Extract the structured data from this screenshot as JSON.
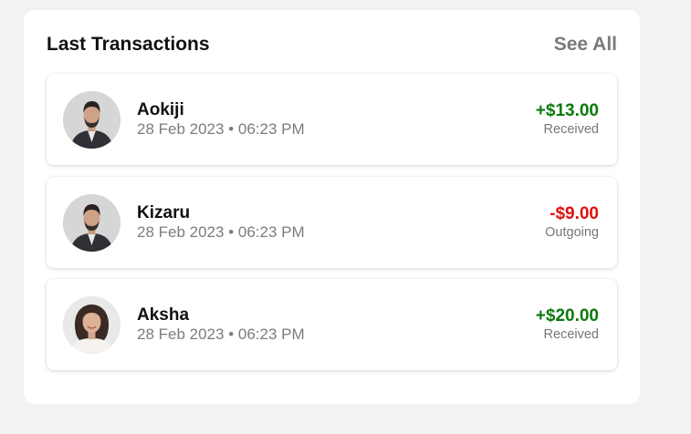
{
  "header": {
    "title": "Last Transactions",
    "see_all_label": "See All"
  },
  "colors": {
    "received": "#0b7a0b",
    "outgoing": "#e01010"
  },
  "transactions": [
    {
      "name": "Aokiji",
      "datetime": "28 Feb 2023 • 06:23 PM",
      "amount": "+$13.00",
      "status": "Received",
      "avatar": "male-avatar-photo"
    },
    {
      "name": "Kizaru",
      "datetime": "28 Feb 2023 • 06:23 PM",
      "amount": "-$9.00",
      "status": "Outgoing",
      "avatar": "male-avatar-photo"
    },
    {
      "name": "Aksha",
      "datetime": "28 Feb 2023 • 06:23 PM",
      "amount": "+$20.00",
      "status": "Received",
      "avatar": "female-avatar-photo"
    }
  ]
}
